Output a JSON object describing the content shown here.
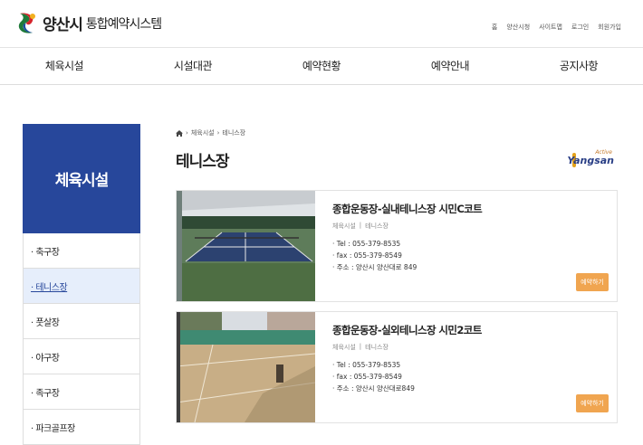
{
  "header": {
    "logo_text": "양산시",
    "logo_sub": "통합예약시스템",
    "util": [
      "홈",
      "양산시청",
      "사이트맵",
      "로그인",
      "회원가입"
    ]
  },
  "gnb": [
    "체육시설",
    "시설대관",
    "예약현황",
    "예약안내",
    "공지사항"
  ],
  "lnb": {
    "title": "체육시설",
    "items": [
      {
        "label": "· 축구장",
        "active": false
      },
      {
        "label": "· 테니스장",
        "active": true
      },
      {
        "label": "· 풋살장",
        "active": false
      },
      {
        "label": "· 야구장",
        "active": false
      },
      {
        "label": "· 족구장",
        "active": false
      },
      {
        "label": "· 파크골프장",
        "active": false
      }
    ]
  },
  "breadcrumb": [
    "체육시설",
    "테니스장"
  ],
  "page_title": "테니스장",
  "brand": {
    "top": "Active",
    "main": "Yangsan"
  },
  "cards": [
    {
      "title": "종합운동장-실내테니스장 시민C코트",
      "category": [
        "체육시설",
        "|",
        "테니스장"
      ],
      "tel": "· Tel : 055-379-8535",
      "fax": "· fax : 055-379-8549",
      "addr": "· 주소 : 양산시 양산대로 849",
      "button": "예약하기"
    },
    {
      "title": "종합운동장-실외테니스장 시민2코트",
      "category": [
        "체육시설",
        "|",
        "테니스장"
      ],
      "tel": "· Tel : 055-379-8535",
      "fax": "· fax : 055-379-8549",
      "addr": "· 주소 : 양산시 양산대로849",
      "button": "예약하기"
    }
  ],
  "colors": {
    "primary": "#27479b",
    "accent": "#f0a550",
    "active_bg": "#e6eefb"
  }
}
